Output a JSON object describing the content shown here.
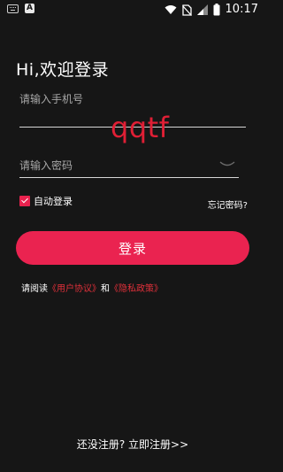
{
  "status_bar": {
    "time": "10:17",
    "icons": [
      "keyboard-icon",
      "a-badge-icon",
      "wifi-icon",
      "no-sim-icon",
      "signal-icon",
      "battery-icon"
    ]
  },
  "greeting": "Hi,欢迎登录",
  "phone": {
    "placeholder": "请输入手机号",
    "value": ""
  },
  "password": {
    "placeholder": "请输入密码",
    "value": ""
  },
  "watermark": "qqtf",
  "remember": {
    "label": "自动登录",
    "checked": true
  },
  "forgot_label": "忘记密码?",
  "login_label": "登录",
  "agreement": {
    "prefix": "请阅读",
    "user_agreement": "《用户协议》",
    "and": "和",
    "privacy_policy": "《隐私政策》"
  },
  "register": {
    "prompt": "还没注册?",
    "action": "立即注册>>"
  },
  "colors": {
    "background": "#161616",
    "accent": "#ea2350",
    "link": "#e0303a"
  }
}
